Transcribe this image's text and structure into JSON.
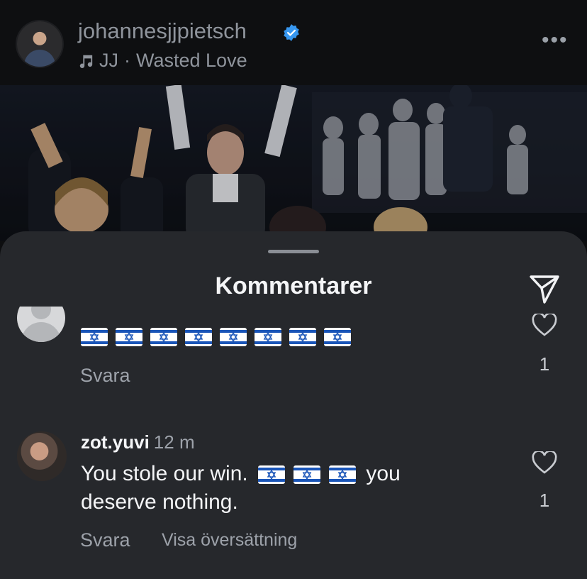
{
  "post": {
    "username": "johannesjjpietsch",
    "verified": true,
    "music_artist": "JJ",
    "music_separator": "·",
    "music_title": "Wasted Love",
    "more_icon": "more-horizontal-icon"
  },
  "comments_sheet": {
    "title": "Kommentarer",
    "send_icon": "paper-plane-icon"
  },
  "comments": [
    {
      "username": "",
      "time": "",
      "text_flags": 8,
      "likes": "1",
      "reply_label": "Svara"
    },
    {
      "username": "zot.yuvi",
      "time": "12 m",
      "text_before": "You stole our win.",
      "text_flags": 3,
      "text_after_1": "you",
      "text_after_2": "deserve nothing.",
      "likes": "1",
      "reply_label": "Svara",
      "translate_label": "Visa översättning"
    }
  ],
  "colors": {
    "sheet_bg": "#26282c",
    "verified_blue": "#3797f0",
    "flag_blue": "#1a55b8"
  }
}
